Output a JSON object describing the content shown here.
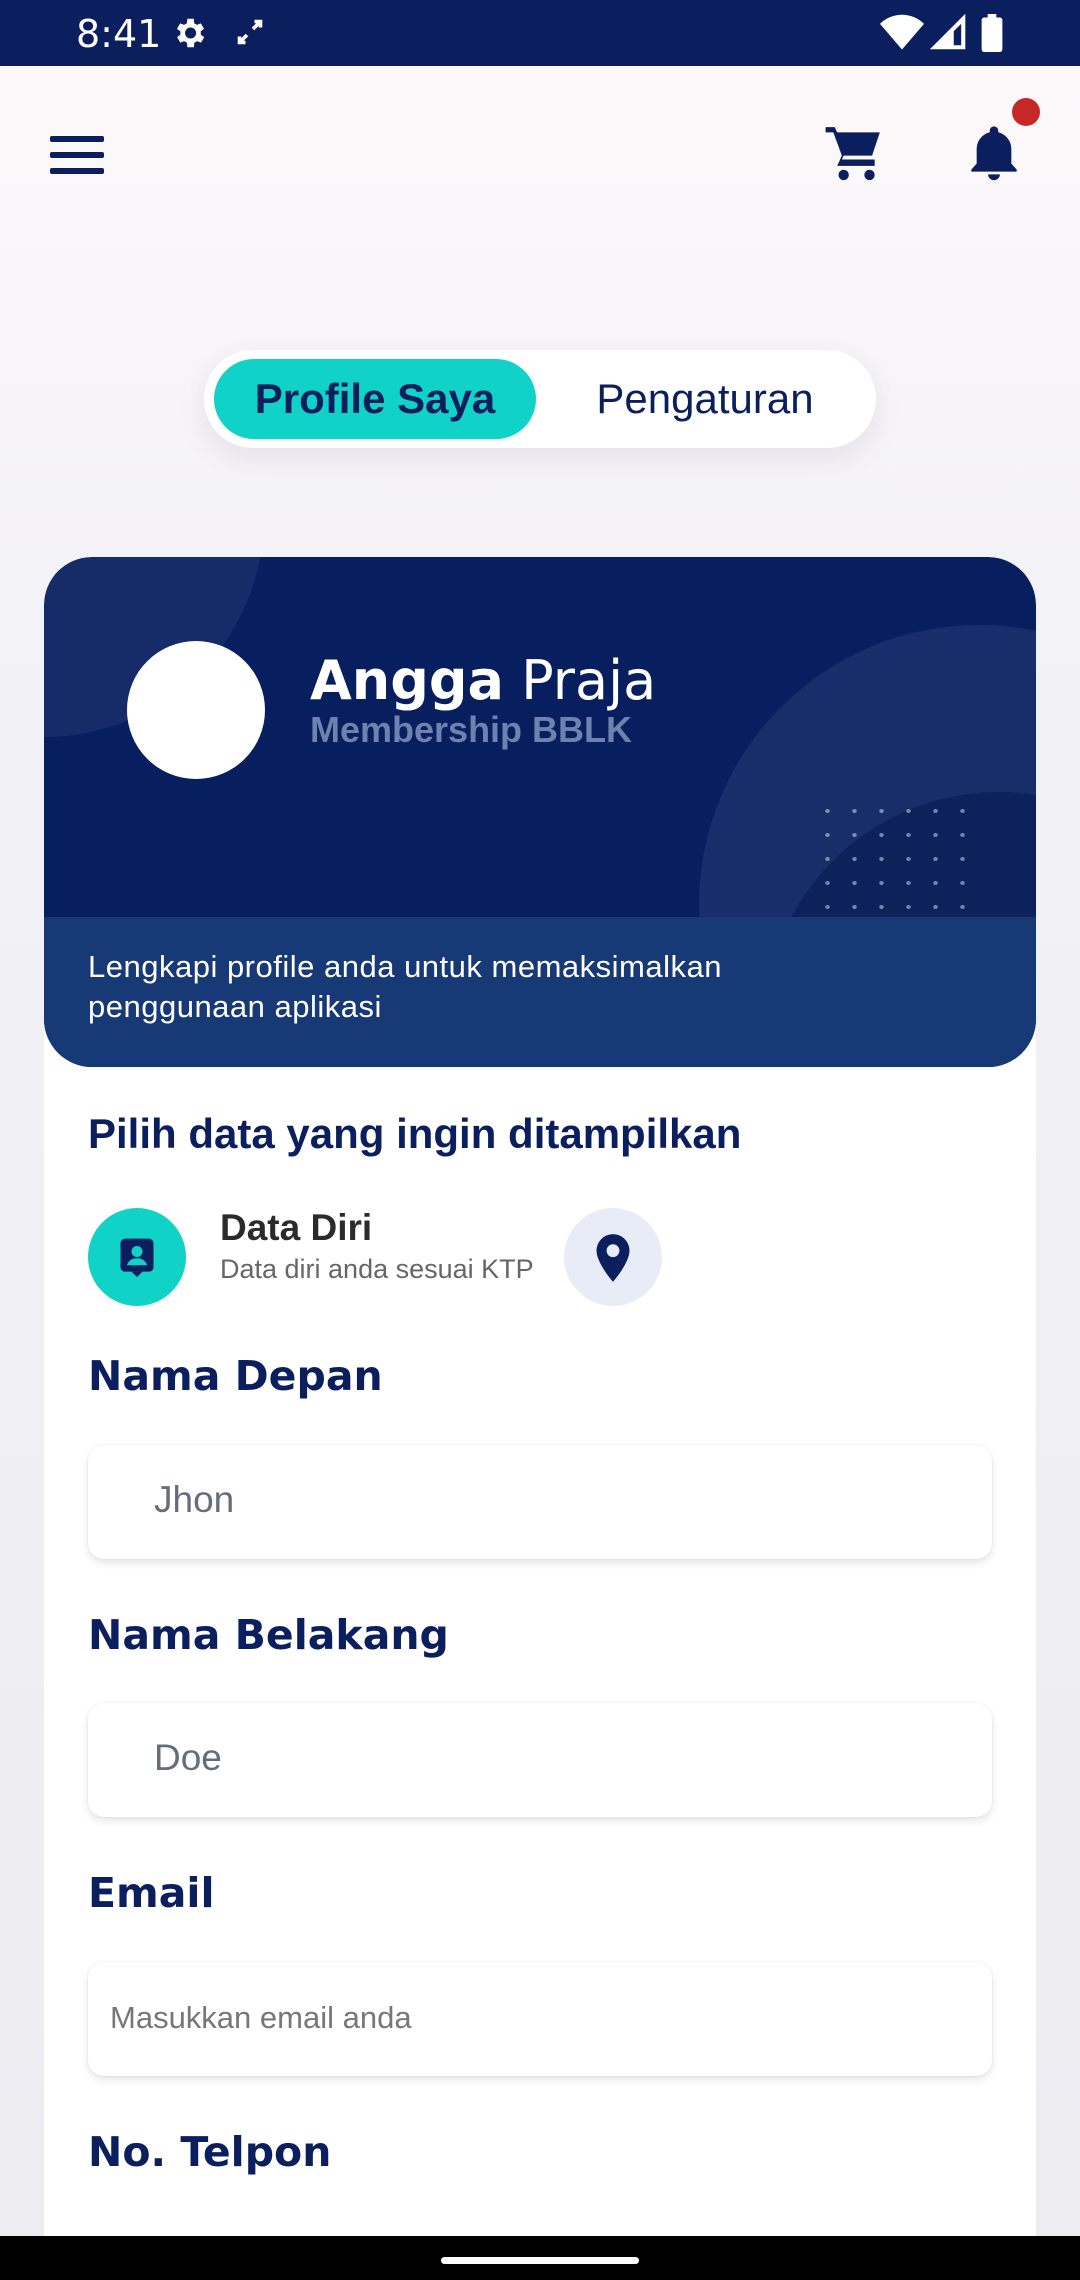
{
  "status_bar": {
    "time": "8:41",
    "icons": [
      "gear-icon",
      "sync-icon",
      "wifi-icon",
      "signal-icon",
      "battery-icon"
    ]
  },
  "topbar": {
    "icons": [
      "menu-icon",
      "cart-icon",
      "bell-icon"
    ],
    "has_notification_dot": true
  },
  "tabs": [
    {
      "label": "Profile Saya",
      "active": true
    },
    {
      "label": "Pengaturan",
      "active": false
    }
  ],
  "profile_card": {
    "first_name": "Angga",
    "last_name": "Praja",
    "membership": "Membership BBLK",
    "message": "Lengkapi profile anda untuk memaksimalkan penggunaan aplikasi"
  },
  "data_selector": {
    "title": "Pilih data yang ingin ditampilkan",
    "active_label": "Data Diri",
    "active_sub": "Data diri anda sesuai KTP"
  },
  "form": {
    "first_name_label": "Nama Depan",
    "first_name_value": "Jhon",
    "last_name_label": "Nama Belakang",
    "last_name_value": "Doe",
    "email_label": "Email",
    "email_placeholder": "Masukkan email anda",
    "phone_label": "No. Telpon"
  },
  "colors": {
    "primary": "#0b1f5e",
    "accent": "#11d2c6",
    "notification": "#c62828"
  }
}
